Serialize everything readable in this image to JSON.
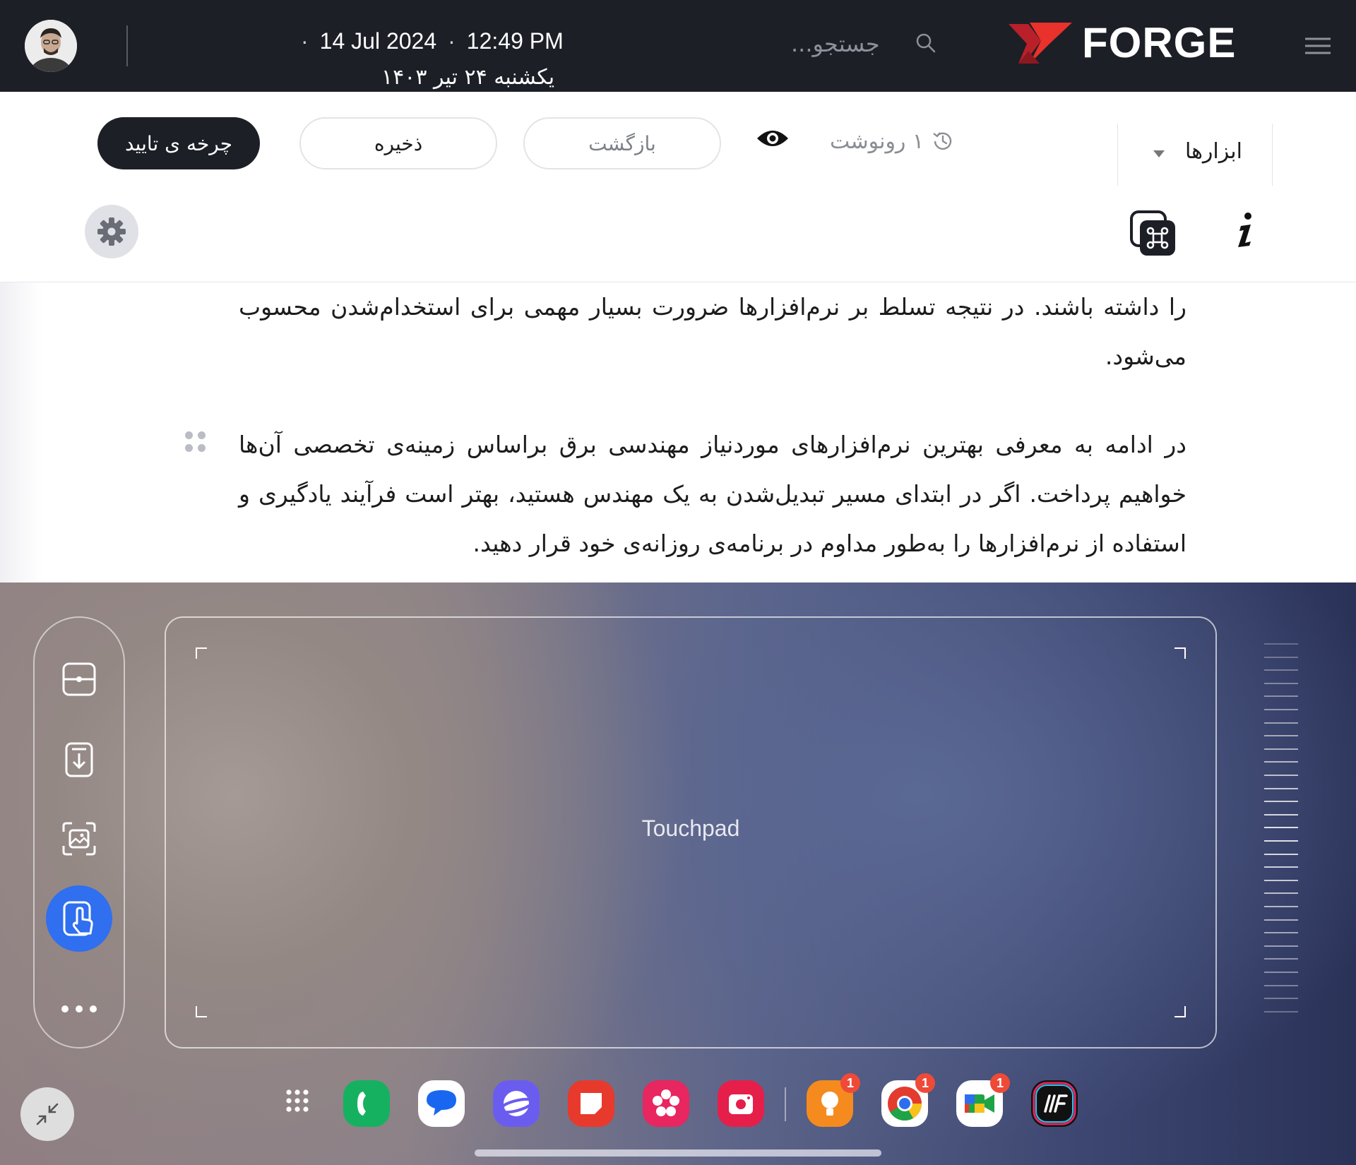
{
  "topbar": {
    "date": "14 Jul 2024",
    "time": "12:49 PM",
    "persian_date": "یکشنبه ۲۴ تیر ۱۴۰۳",
    "search_placeholder": "جستجو...",
    "logo_text": "FORGE",
    "colors": {
      "background": "#1c1f26",
      "logo_accent": "#e8322b"
    }
  },
  "toolbar": {
    "tools_label": "ابزارها",
    "revision_label": "۱ رونوشت",
    "back_label": "بازگشت",
    "save_label": "ذخیره",
    "approve_label": "چرخه ی تایید"
  },
  "content": {
    "paragraph1": "را داشته باشند. در نتیجه تسلط بر نرم‌افزارها ضرورت بسیار مهمی برای استخدام‌شدن محسوب می‌شود.",
    "paragraph2": "در ادامه به معرفی بهترین نرم‌افزارهای موردنیاز مهندسی برق براساس زمینه‌ی تخصصی آن‌ها خواهیم پرداخت. اگر در ابتدای مسیر تبدیل‌شدن به یک مهندس هستید، بهتر است فرآیند یادگیری و استفاده از نرم‌افزارها را به‌طور مداوم در برنامه‌ی روزانه‌ی خود قرار دهید."
  },
  "touchpad": {
    "label": "Touchpad",
    "rail_tools": [
      "split-screen-icon",
      "download-screen-icon",
      "capture-image-icon",
      "touchpad-pointer-icon",
      "more-icon"
    ],
    "active_tool": "touchpad-pointer-icon",
    "accent": "#2f6ff0"
  },
  "dock": {
    "apps": [
      {
        "name": "app-drawer",
        "badge": ""
      },
      {
        "name": "phone",
        "badge": ""
      },
      {
        "name": "messages",
        "badge": ""
      },
      {
        "name": "samsung-internet",
        "badge": ""
      },
      {
        "name": "samsung-notes",
        "badge": ""
      },
      {
        "name": "blossom-gallery",
        "badge": ""
      },
      {
        "name": "camera",
        "badge": ""
      },
      {
        "name": "tips",
        "badge": "1"
      },
      {
        "name": "chrome",
        "badge": "1"
      },
      {
        "name": "google-meet",
        "badge": "1"
      },
      {
        "name": "forge-app",
        "badge": ""
      }
    ]
  }
}
